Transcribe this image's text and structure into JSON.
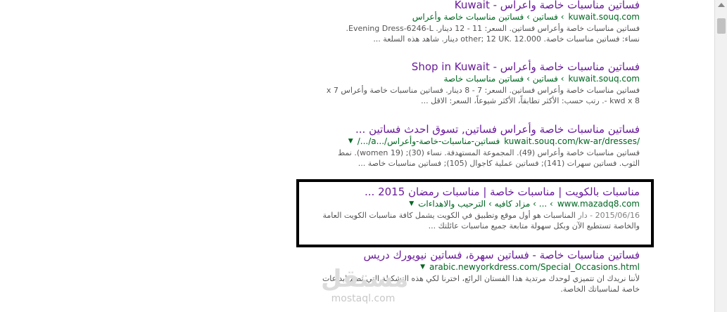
{
  "results": [
    {
      "title": "فساتين مناسبات خاصة وأعراس - Kuwait",
      "domain": "kuwait.souq.com",
      "crumbs": "› فساتين › فساتين مناسبات خاصة وأعراس",
      "snippet1": "فساتين مناسبات خاصة وأعراس فساتين. السعر: 11 - 12 دينار. Evening Dress-6246-L.",
      "snippet2": "نساء: فساتين مناسبات خاصة. other; 12 UK. 12.000 دينار. شاهد هذه السلعة ..."
    },
    {
      "title": "فساتين مناسبات خاصة وأعراس - Shop in Kuwait",
      "domain": "kuwait.souq.com",
      "crumbs": "› فساتين › فساتين مناسبات خاصة",
      "snippet1": "فساتين مناسبات خاصة وأعراس فساتين. السعر: 7 - 8 دينار. فساتين مناسبات خاصة وأعراس 7 x",
      "snippet2": "8 kwd x -. رتب حسب: الأكثر تطابقاً، الأكثر شيوعاً، السعر: الاقل ..."
    },
    {
      "title": "فساتين مناسبات خاصة وأعراس فساتين, تسوق احدث فساتين ...",
      "domain": "kuwait.souq.com/kw-ar/dresses/",
      "crumbs": "فساتين-مناسبات-خاصة-وأعراس/...a/.../",
      "snippet1": "فساتين مناسبات خاصة وأعراس (49). المجموعة المستهدفة. نساء (30); (19 women). نمط",
      "snippet2": "الثوب. فساتين سهرات (141); فساتين عملية كاجوال (105); فساتين مناسبات خاصة ..."
    },
    {
      "title": "مناسبات بالكويت | مناسبات خاصة | مناسبات رمضان 2015 ...",
      "domain": "www.mazadq8.com",
      "crumbs": "› ... › مزاد كافيه › الترحيب والاهداءات",
      "date": "2015/06/16 - دار",
      "snippet1": "المناسبات هو أول موقع وتطبيق في الكويت يشمل كافة مناسبات الكويت العامة",
      "snippet2": "والخاصة تستطيع الآن وبكل سهولة متابعة جميع مناسبات عائلتك ..."
    },
    {
      "title": "فساتين مناسبات خاصة - فساتين سهرة، فساتين نيويورك دريس",
      "domain": "arabic.newyorkdress.com/Special_Occasions.html",
      "crumbs": "",
      "snippet1": "لأننا نريدك ان تتميزي لوحدك مرتدية هذا الفستان الرائع، اخترنا لكي هذه التشكيلة التي تضم ابداعات",
      "snippet2": "خاصة لمناسباتك الخاصة."
    }
  ],
  "watermark": {
    "ar": "مستقل",
    "en": "mostaql.com"
  },
  "colors": {
    "title": "#6a1b9a",
    "url": "#006621",
    "snippet": "#545454",
    "box": "#000000"
  }
}
